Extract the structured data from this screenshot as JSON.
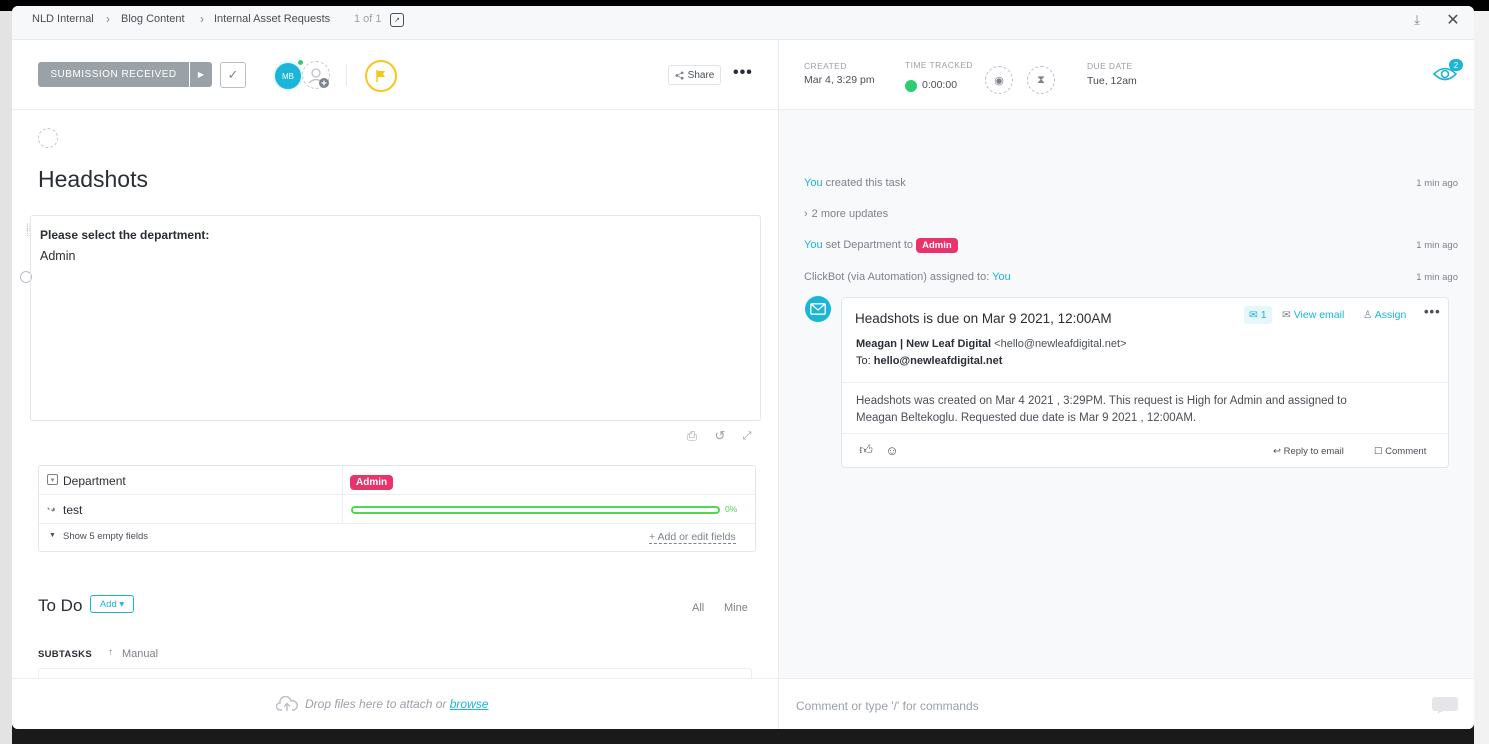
{
  "breadcrumb": {
    "items": [
      "NLD Internal",
      "Blog Content",
      "Internal Asset Requests"
    ],
    "position": "1 of 1"
  },
  "toolbar": {
    "status_label": "SUBMISSION RECEIVED",
    "assignee_initials": "MB",
    "share_label": "Share",
    "more_label": "•••"
  },
  "meta": {
    "created_label": "CREATED",
    "created_value": "Mar 4, 3:29 pm",
    "time_tracked_label": "TIME TRACKED",
    "time_tracked_value": "0:00:00",
    "due_date_label": "DUE DATE",
    "due_date_value": "Tue, 12am",
    "watchers_count": "2"
  },
  "task": {
    "title": "Headshots",
    "description_question": "Please select the department:",
    "description_answer": "Admin"
  },
  "fields": {
    "department_label": "Department",
    "department_value": "Admin",
    "test_label": "test",
    "test_progress": "0%",
    "show_empty_label": "Show 5 empty fields",
    "add_fields_label": "+ Add or edit fields"
  },
  "todo": {
    "title": "To Do",
    "add_label": "Add ▾",
    "filter_all": "All",
    "filter_mine": "Mine",
    "subtasks_label": "SUBTASKS",
    "sort_label": "Manual"
  },
  "footer": {
    "drop_text": "Drop files here to attach or",
    "browse_label": "browse",
    "comment_placeholder": "Comment or type '/' for commands"
  },
  "activity": [
    {
      "actor": "You",
      "text": " created this task",
      "time": "1 min ago"
    },
    {
      "text": "2 more updates"
    },
    {
      "actor": "You",
      "text": " set Department to ",
      "badge": "Admin",
      "time": "1 min ago"
    },
    {
      "text": "ClickBot (via Automation) assigned to: ",
      "target": "You",
      "time": "1 min ago"
    }
  ],
  "email": {
    "subject": "Headshots is due on Mar 9 2021, 12:00AM",
    "reply_count": "1",
    "view_email_label": "View email",
    "assign_label": "Assign",
    "from_name": "Meagan | New Leaf Digital",
    "from_addr": "<hello@newleafdigital.net>",
    "to_label": "To:",
    "to_addr": "hello@newleafdigital.net",
    "body_line1": "Headshots was created on Mar 4 2021 , 3:29PM. This request is High for Admin and assigned to",
    "body_line2": "Meagan Beltekoglu. Requested due date is Mar 9 2021 , 12:00AM.",
    "reply_label": "Reply to email",
    "comment_label": "Comment"
  },
  "colors": {
    "accent": "#1ab5d9",
    "admin_badge": "#e8336b",
    "progress": "#55d35a",
    "flag": "#f8c71c",
    "status": "#9aa2a8"
  }
}
